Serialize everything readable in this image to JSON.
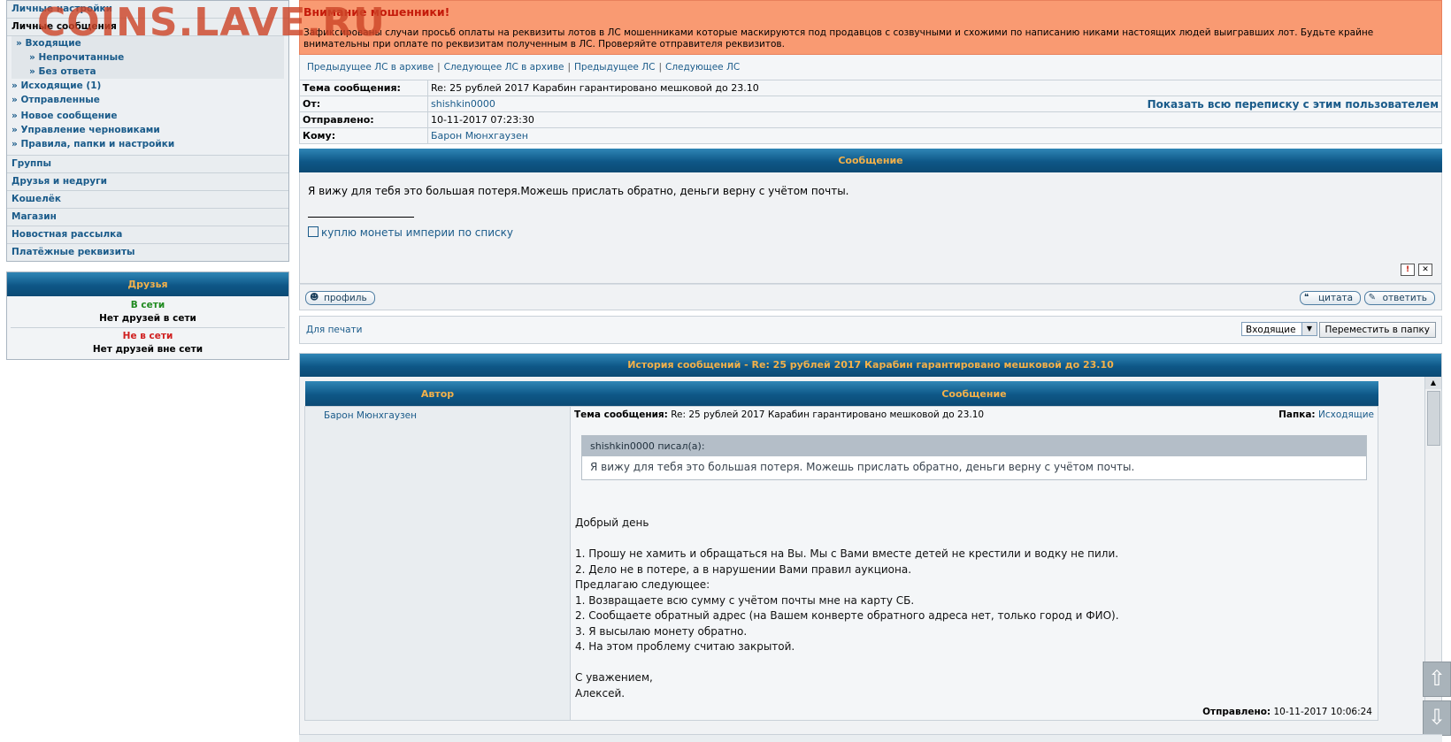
{
  "watermark": "COINS.LAVE.RU",
  "sidebar": {
    "personal_settings": "Личные настройки",
    "personal_messages": "Личные сообщения",
    "inbox": "Входящие",
    "unread": "Непрочитанные",
    "unanswered": "Без ответа",
    "outbox": "Исходящие (1)",
    "sent": "Отправленные",
    "new_message": "Новое сообщение",
    "drafts": "Управление черновиками",
    "rules": "Правила, папки и настройки",
    "groups": "Группы",
    "friends_foes": "Друзья и недруги",
    "wallet": "Кошелёк",
    "shop": "Магазин",
    "newsletter": "Новостная рассылка",
    "payment": "Платёжные реквизиты",
    "bullet": "»"
  },
  "friends": {
    "title": "Друзья",
    "online": "В сети",
    "no_online": "Нет друзей в сети",
    "offline": "Не в сети",
    "no_offline": "Нет друзей вне сети"
  },
  "warning": {
    "title": "Внимание мошенники!",
    "text": "Зафиксированы случаи просьб оплаты на реквизиты лотов в ЛС мошенниками которые маскируются под продавцов с созвучными и схожими по написанию никами настоящих людей выигравших лот. Будьте крайне внимательны при оплате по реквизитам полученным в ЛС. Проверяйте отправителя реквизитов."
  },
  "nav": {
    "prev_archive": "Предыдущее ЛС в архиве",
    "next_archive": "Следующее ЛС в архиве",
    "prev": "Предыдущее ЛС",
    "next": "Следующее ЛС",
    "sep": "|"
  },
  "header": {
    "subject_label": "Тема сообщения:",
    "subject": "Re: 25 рублей 2017 Карабин гарантировано мешковой до 23.10",
    "from_label": "От:",
    "from": "shishkin0000",
    "show_all": "Показать всю переписку с этим пользователем",
    "sent_label": "Отправлено:",
    "sent": "10-11-2017 07:23:30",
    "to_label": "Кому:",
    "to": "Барон Мюнхгаузен"
  },
  "message": {
    "title": "Сообщение",
    "text": "Я вижу для тебя это большая потеря.Можешь прислать обратно, деньги верну с учётом почты.",
    "signature_link": "куплю монеты империи по списку"
  },
  "buttons": {
    "profile": "профиль",
    "quote": "цитата",
    "reply": "ответить",
    "print": "Для печати",
    "folder": "Входящие",
    "move": "Переместить в папку"
  },
  "history": {
    "title": "История сообщений - Re: 25 рублей 2017 Карабин гарантировано мешковой до 23.10",
    "col_author": "Автор",
    "col_message": "Сообщение",
    "author": "Барон Мюнхгаузен",
    "subject_label": "Тема сообщения:",
    "subject": "Re: 25 рублей 2017 Карабин гарантировано мешковой до 23.10",
    "folder_label": "Папка:",
    "folder": "Исходящие",
    "quote_head": "shishkin0000 писал(а):",
    "quote_body": "Я вижу для тебя это большая потеря. Можешь прислать обратно, деньги верну с учётом почты.",
    "reply_lines": [
      "Добрый день",
      "",
      "1. Прошу не хамить и обращаться на Вы. Мы с Вами вместе детей не крестили и водку не пили.",
      "2. Дело не в потере, а в нарушении Вами правил аукциона.",
      "Предлагаю следующее:",
      "1. Возвращаете всю сумму с учётом почты мне на карту СБ.",
      "2. Сообщаете обратный адрес (на Вашем конверте обратного адреса нет, только город и ФИО).",
      "3. Я высылаю монету обратно.",
      "4. На этом проблему считаю закрытой.",
      "",
      "С уважением,",
      "Алексей."
    ],
    "sent_label": "Отправлено:",
    "sent": "10-11-2017 10:06:24"
  },
  "icons": {
    "report": "!",
    "delete": "✕",
    "profile": "profile-icon",
    "quote": "quote-icon",
    "reply": "reply-icon",
    "scroll_up": "⇧",
    "scroll_down": "⇩",
    "dropdown": "▼",
    "scroll_arrow": "▲"
  }
}
